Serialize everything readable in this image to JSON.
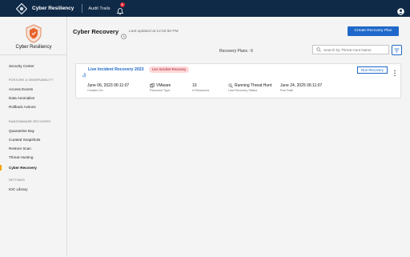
{
  "topbar": {
    "app_name": "Cyber Resiliency",
    "audit_trails": "Audit Trails",
    "notification_count": "8"
  },
  "sidebar": {
    "brand": "Cyber Resiliency",
    "top_item": "Security Center",
    "sections": [
      {
        "heading": "POSTURE & OBSERVABILITY",
        "items": [
          "Access Events",
          "Data Anomalies",
          "Rollback Actions"
        ]
      },
      {
        "heading": "RANSOMWARE RECOVERY",
        "items": [
          "Quarantine Bay",
          "Curated Snapshots",
          "Restore Scan",
          "Threat Hunting",
          "Cyber Recovery"
        ]
      },
      {
        "heading": "SETTINGS",
        "items": [
          "IOC Library"
        ]
      }
    ],
    "active_item": "Cyber Recovery"
  },
  "main": {
    "title": "Cyber Recovery",
    "last_updated": "Last updated at 12:02:50 PM",
    "create_button": "Create Recovery Plan",
    "plans_count": "Recovery Plans : 6",
    "search_placeholder": "Search by Threat Hunt Name"
  },
  "plan": {
    "name": "Live Incident Recovery 2023",
    "tag": "Live Incident Recovery",
    "run_button": "Run Recovery",
    "fields": [
      {
        "value": "June 06, 2023 06:11:07",
        "label": "Created On",
        "icon": ""
      },
      {
        "value": "VMware",
        "label": "Resource Type",
        "icon": "vmware-icon"
      },
      {
        "value": "10",
        "label": "# Resources",
        "icon": ""
      },
      {
        "value": "Running Threat Hunt",
        "label": "Last Recovery Status",
        "icon": "threat-hunt-icon"
      },
      {
        "value": "June 24, 2025 06:11:07",
        "label": "Run Date",
        "icon": ""
      }
    ]
  },
  "colors": {
    "topbar": "#0f2a47",
    "accent": "#1f68c9",
    "active_marker": "#f0a500",
    "tag_bg": "#ffd7d9",
    "badge": "#e0262f"
  }
}
